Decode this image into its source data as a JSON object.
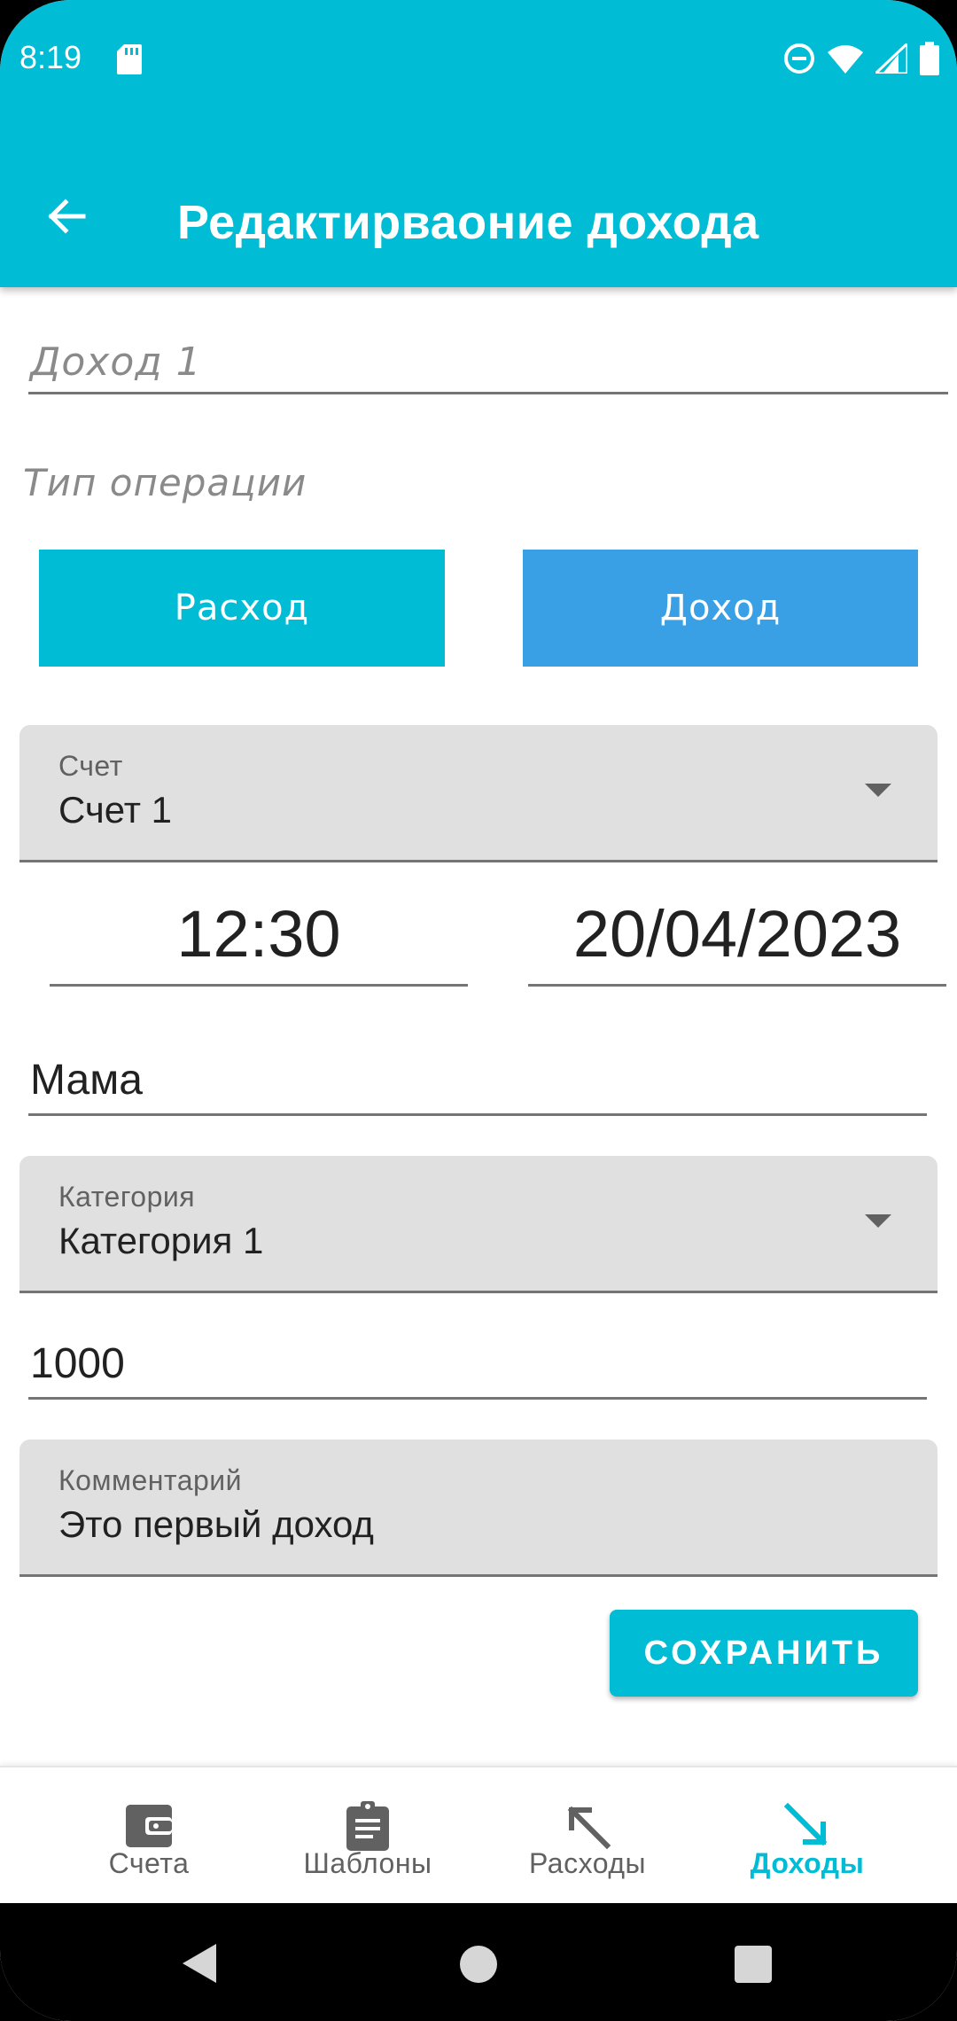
{
  "status_bar": {
    "time": "8:19",
    "icons": [
      "sd-card-icon",
      "dnd-icon",
      "wifi-icon",
      "signal-icon",
      "battery-icon"
    ]
  },
  "app_bar": {
    "title": "Редактирваоние дохода",
    "back_icon": "arrow-back-icon"
  },
  "form": {
    "name_placeholder": "Доход 1",
    "operation_type_label": "Тип операции",
    "expense_button": "Расход",
    "income_button": "Доход",
    "account": {
      "label": "Счет",
      "value": "Счет 1"
    },
    "time": "12:30",
    "date": "20/04/2023",
    "source": "Мама",
    "category": {
      "label": "Категория",
      "value": "Категория 1"
    },
    "amount": "1000",
    "comment": {
      "label": "Комментарий",
      "value": "Это первый доход"
    },
    "save_button": "СОХРАНИТЬ"
  },
  "bottom_nav": {
    "items": [
      {
        "label": "Счета",
        "icon": "wallet-icon",
        "active": false
      },
      {
        "label": "Шаблоны",
        "icon": "clipboard-icon",
        "active": false
      },
      {
        "label": "Расходы",
        "icon": "arrow-up-left-icon",
        "active": false
      },
      {
        "label": "Доходы",
        "icon": "arrow-down-right-icon",
        "active": true
      }
    ]
  },
  "colors": {
    "primary": "#00BCD4",
    "income_button": "#39A0E6",
    "field_bg": "#E0E0E0"
  }
}
